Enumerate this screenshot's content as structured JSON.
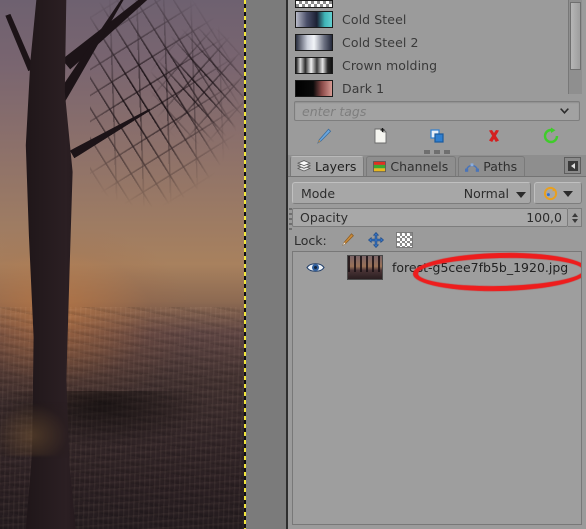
{
  "canvas": {
    "name": "image-canvas",
    "description": "Photograph of a bare tree silhouette against a hazy orange sunset sky with dark leaf-covered ground",
    "selection_border": "marching-ants-dashed"
  },
  "gradients_panel": {
    "scroll_position": "partial-top-row-cut-off",
    "items": [
      {
        "label": "",
        "swatch": "checkerboard",
        "partial": true
      },
      {
        "label": "Cold Steel",
        "swatch": "linear-gradient(to right, #b9bbc9 0%, #4a4f69 30%, #1b2033 58%, #3fb5b8 80%, #63cfd0 100%)"
      },
      {
        "label": "Cold Steel 2",
        "swatch": "linear-gradient(to right, #2a2f3f 0%, #cdd1dc 32%, #f2f4f8 50%, #6c7182 78%, #23283a 100%)"
      },
      {
        "label": "Crown molding",
        "swatch": "linear-gradient(to right, #1a1a1a 0%, #d8d8d8 12%, #2c2c2c 26%, #f0f0f0 42%, #3a3a3a 58%, #e6e6e6 74%, #2a2a2a 88%, #111 100%)"
      },
      {
        "label": "Dark 1",
        "swatch": "linear-gradient(to right, #000000 0%, #0a0a0a 48%, #8a4a48 72%, #d79a93 100%)"
      }
    ]
  },
  "tag_entry": {
    "placeholder": "enter tags",
    "value": "",
    "dropdown_arrow": "chevron-down-icon"
  },
  "gradient_toolbar": {
    "buttons": [
      {
        "name": "edit-gradient-button",
        "icon": "pencil-icon",
        "color": "#6aa7e0"
      },
      {
        "name": "new-gradient-button",
        "icon": "new-document-icon",
        "color": "#f5f5f0"
      },
      {
        "name": "duplicate-gradient-button",
        "icon": "duplicate-icon",
        "color": "#2f7fd0"
      },
      {
        "name": "delete-gradient-button",
        "icon": "delete-x-icon",
        "color": "#d42020"
      },
      {
        "name": "refresh-gradients-button",
        "icon": "refresh-icon",
        "color": "#3fcc2a"
      }
    ]
  },
  "dock_tabs": {
    "tabs": [
      {
        "label": "Layers",
        "icon": "layers-icon",
        "active": true
      },
      {
        "label": "Channels",
        "icon": "channels-icon",
        "active": false
      },
      {
        "label": "Paths",
        "icon": "paths-icon",
        "active": false
      }
    ],
    "menu_button": {
      "name": "dock-menu-button",
      "icon": "left-triangle-icon"
    }
  },
  "layer_controls": {
    "mode_label": "Mode",
    "mode_value": "Normal",
    "mode_chevron": "chevron-down-icon",
    "blend_space_icon": "blend-space-icon",
    "blend_space_chevron": "chevron-down-icon",
    "opacity_label": "Opacity",
    "opacity_value": "100,0",
    "opacity_percent": 100,
    "lock_label": "Lock:",
    "lock_buttons": [
      {
        "name": "lock-pixels-button",
        "icon": "brush-icon"
      },
      {
        "name": "lock-position-button",
        "icon": "move-cross-icon"
      },
      {
        "name": "lock-alpha-button",
        "icon": "alpha-checker-icon"
      }
    ]
  },
  "layers": {
    "rows": [
      {
        "visible": true,
        "visibility_icon": "eye-icon",
        "thumbnail": "forest-thumbnail",
        "name": "forest-g5cee7fb5b_1920.jpg",
        "selected": false,
        "annotated": true
      }
    ]
  },
  "annotation": {
    "shape": "ellipse",
    "color": "#ee1d1d",
    "target": "forest-g5cee7fb5b_1920.jpg"
  },
  "colors": {
    "dock_bg": "#9b9b9b",
    "panel_bg": "#9e9e9e",
    "canvas_pad": "#7b7b7b",
    "text": "#2d2d2d",
    "selection_yellow": "#f2e63c",
    "annotation_red": "#ee1d1d"
  }
}
